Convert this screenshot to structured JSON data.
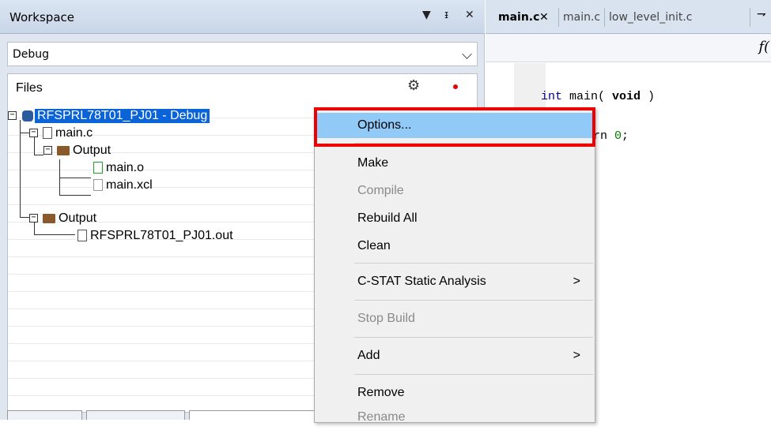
{
  "workspace": {
    "title": "Workspace",
    "config": "Debug",
    "tree_header": "Files",
    "nodes": {
      "project": "RFSPRL78T01_PJ01 - Debug",
      "main_c": "main.c",
      "output1": "Output",
      "main_o": "main.o",
      "main_xcl": "main.xcl",
      "output2": "Output",
      "out_file": "RFSPRL78T01_PJ01.out"
    },
    "title_buttons": {
      "dropdown": "▼",
      "pin": "ᵻ",
      "close": "✕"
    }
  },
  "editor": {
    "tabs": [
      "main.c",
      "main.c",
      "low_level_init.c"
    ],
    "tab_close": "✕",
    "overflow": "⇁",
    "func_icon": "f(",
    "code": {
      "line1_kw": "int",
      "line1_name": " main( ",
      "line1_void": "void",
      "line1_end": " )",
      "line2_pre": "rn ",
      "line2_num": "0",
      "line2_end": ";"
    }
  },
  "context_menu": {
    "items": [
      {
        "label": "Options...",
        "state": "highlighted"
      },
      {
        "label": "Make",
        "state": "enabled"
      },
      {
        "label": "Compile",
        "state": "disabled"
      },
      {
        "label": "Rebuild All",
        "state": "enabled"
      },
      {
        "label": "Clean",
        "state": "enabled"
      },
      {
        "label": "C-STAT Static Analysis",
        "state": "enabled",
        "submenu": ">"
      },
      {
        "label": "Stop Build",
        "state": "disabled"
      },
      {
        "label": "Add",
        "state": "enabled",
        "submenu": ">"
      },
      {
        "label": "Remove",
        "state": "enabled"
      },
      {
        "label": "Rename",
        "state": "disabled"
      }
    ]
  },
  "colors": {
    "selection": "#0a64d8",
    "menu_highlight": "#91c9f7",
    "callout": "#e00000",
    "keyword": "#000080"
  }
}
